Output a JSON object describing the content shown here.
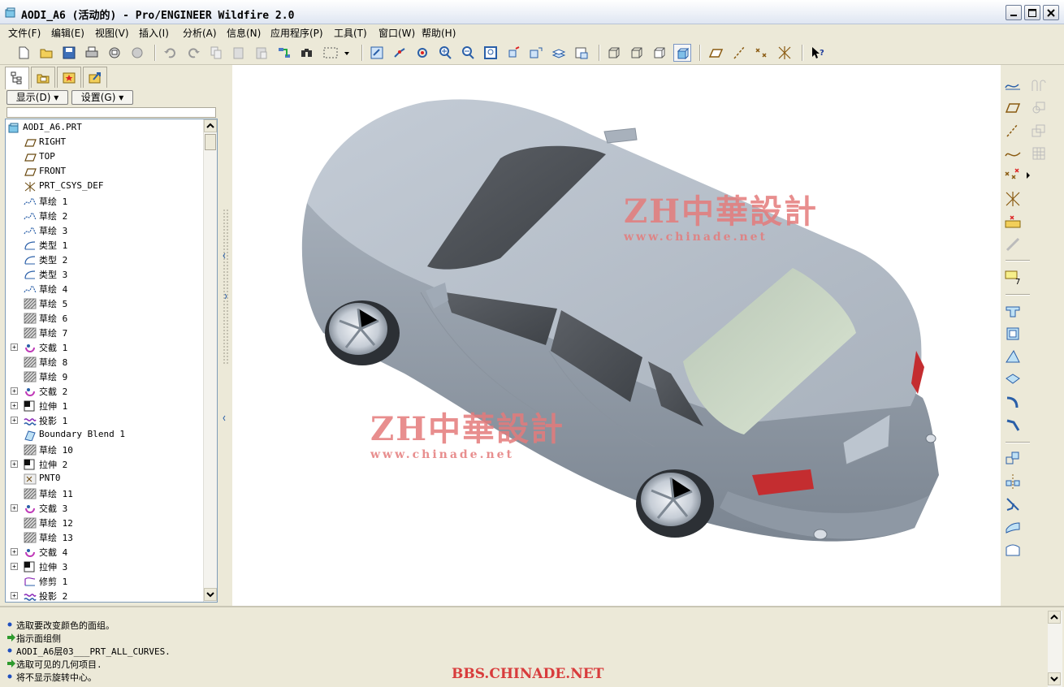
{
  "window": {
    "title": "AODI_A6 (活动的) - Pro/ENGINEER Wildfire 2.0"
  },
  "menubar": {
    "items": [
      "文件(F)",
      "编辑(E)",
      "视图(V)",
      "插入(I)",
      "分析(A)",
      "信息(N)",
      "应用程序(P)",
      "工具(T)",
      "窗口(W)",
      "帮助(H)"
    ]
  },
  "toolbar": {
    "icons": [
      "new-icon",
      "open-icon",
      "save-icon",
      "print-icon",
      "send-mail-icon",
      "mail-icon",
      "undo-icon",
      "redo-icon",
      "copy-icon",
      "paste-icon",
      "paste-special-icon",
      "regenerate-icon",
      "find-icon",
      "select-box-icon",
      "dropdown-icon",
      "repaint-icon",
      "spin-center-icon",
      "orient-icon",
      "zoom-in-icon",
      "zoom-out-icon",
      "refit-icon",
      "reorient-icon",
      "saved-views-icon",
      "layers-icon",
      "view-manager-icon",
      "wireframe-icon",
      "hidden-line-icon",
      "no-hidden-icon",
      "shading-icon",
      "datum-planes-icon",
      "datum-axes-icon",
      "datum-points-icon",
      "csys-icon",
      "context-help-icon"
    ]
  },
  "leftpanel": {
    "tabs": [
      "model-tree-tab",
      "folder-browser-tab",
      "favorites-tab",
      "connections-tab"
    ],
    "show_button": "显示(D)",
    "settings_button": "设置(G)",
    "tree": [
      {
        "label": "AODI_A6.PRT",
        "icon": "part-icon",
        "expandable": false,
        "root": true
      },
      {
        "label": "RIGHT",
        "icon": "datum-plane-icon",
        "expandable": false
      },
      {
        "label": "TOP",
        "icon": "datum-plane-icon",
        "expandable": false
      },
      {
        "label": "FRONT",
        "icon": "datum-plane-icon",
        "expandable": false
      },
      {
        "label": "PRT_CSYS_DEF",
        "icon": "csys-icon",
        "expandable": false
      },
      {
        "label": "草绘 1",
        "icon": "sketch-icon",
        "expandable": false
      },
      {
        "label": "草绘 2",
        "icon": "sketch-icon",
        "expandable": false
      },
      {
        "label": "草绘 3",
        "icon": "sketch-icon",
        "expandable": false
      },
      {
        "label": "类型 1",
        "icon": "curve-icon",
        "expandable": false
      },
      {
        "label": "类型 2",
        "icon": "curve-icon",
        "expandable": false
      },
      {
        "label": "类型 3",
        "icon": "curve-icon",
        "expandable": false
      },
      {
        "label": "草绘 4",
        "icon": "sketch-icon",
        "expandable": false
      },
      {
        "label": "草绘 5",
        "icon": "hatched-sketch-icon",
        "expandable": false
      },
      {
        "label": "草绘 6",
        "icon": "hatched-sketch-icon",
        "expandable": false
      },
      {
        "label": "草绘 7",
        "icon": "hatched-sketch-icon",
        "expandable": false
      },
      {
        "label": "交截 1",
        "icon": "intersect-icon",
        "expandable": true
      },
      {
        "label": "草绘 8",
        "icon": "hatched-sketch-icon",
        "expandable": false
      },
      {
        "label": "草绘 9",
        "icon": "hatched-sketch-icon",
        "expandable": false
      },
      {
        "label": "交截 2",
        "icon": "intersect-icon",
        "expandable": true
      },
      {
        "label": "拉伸 1",
        "icon": "extrude-icon",
        "expandable": true
      },
      {
        "label": "投影 1",
        "icon": "project-icon",
        "expandable": true
      },
      {
        "label": "Boundary Blend 1",
        "icon": "boundary-blend-icon",
        "expandable": false
      },
      {
        "label": "草绘 10",
        "icon": "hatched-sketch-icon",
        "expandable": false
      },
      {
        "label": "拉伸 2",
        "icon": "extrude-icon",
        "expandable": true
      },
      {
        "label": "PNT0",
        "icon": "datum-point-icon",
        "expandable": false
      },
      {
        "label": "草绘 11",
        "icon": "hatched-sketch-icon",
        "expandable": false
      },
      {
        "label": "交截 3",
        "icon": "intersect-icon",
        "expandable": true
      },
      {
        "label": "草绘 12",
        "icon": "hatched-sketch-icon",
        "expandable": false
      },
      {
        "label": "草绘 13",
        "icon": "hatched-sketch-icon",
        "expandable": false
      },
      {
        "label": "交截 4",
        "icon": "intersect-icon",
        "expandable": true
      },
      {
        "label": "拉伸 3",
        "icon": "extrude-icon",
        "expandable": true
      },
      {
        "label": "修剪 1",
        "icon": "trim-icon",
        "expandable": false
      },
      {
        "label": "投影 2",
        "icon": "project-icon",
        "expandable": true
      }
    ]
  },
  "viewport": {
    "watermark_brand": "ZH中華設計",
    "watermark_url": "www.chinade.net"
  },
  "righttoolbar": {
    "icons": [
      "sketch-tool-icon",
      "datum-plane-tool-icon",
      "datum-axis-tool-icon",
      "datum-curve-tool-icon",
      "datum-point-tool-icon",
      "csys-tool-icon",
      "analysis-tool-icon",
      "annotation-icon",
      "extrude-tool-icon",
      "revolve-tool-icon",
      "hole-tool-icon",
      "shell-tool-icon",
      "rib-tool-icon",
      "round-tool-icon",
      "chamfer-tool-icon",
      "draft-tool-icon",
      "copy-tool-icon",
      "mirror-tool-icon",
      "merge-tool-icon",
      "trim-tool-icon",
      "offset-tool-icon",
      "quilt-icon"
    ]
  },
  "messages": [
    {
      "icon": "info",
      "text": "选取要改变颜色的面组。"
    },
    {
      "icon": "prompt",
      "text": "指示面组侧"
    },
    {
      "icon": "info",
      "text": "AODI_A6层03___PRT_ALL_CURVES."
    },
    {
      "icon": "prompt",
      "text": "选取可见的几何项目."
    },
    {
      "icon": "info",
      "text": "将不显示旋转中心。"
    }
  ],
  "footer_watermark": "BBS.CHINADE.NET",
  "colors": {
    "info_bullet": "#1f4fbf",
    "prompt_arrow": "#2e9a2e",
    "watermark": "#d83c3c",
    "car_body": "#b9c2cc"
  }
}
